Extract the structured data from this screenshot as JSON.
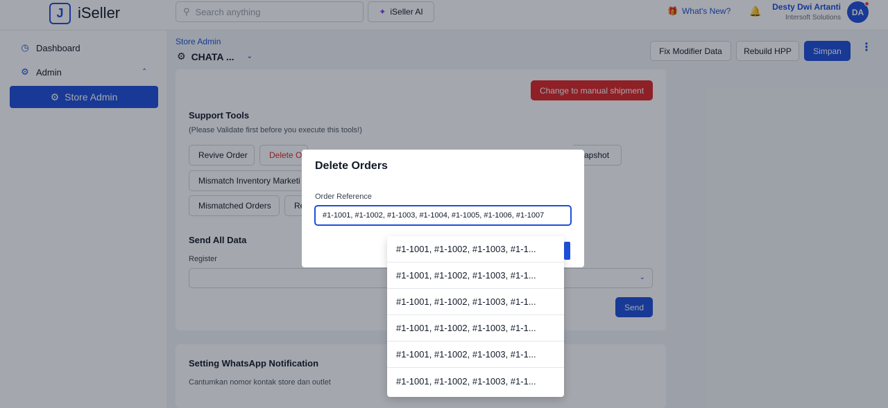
{
  "topbar": {
    "logo_text": "iSeller",
    "search_placeholder": "Search anything",
    "ai_label": "iSeller AI",
    "whats_new": "What's New?",
    "user_name": "Desty Dwi Artanti",
    "user_org": "Intersoft Solutions",
    "avatar_initials": "DA"
  },
  "sidebar": {
    "items": [
      {
        "label": "Dashboard",
        "icon": "dashboard-icon"
      },
      {
        "label": "Admin",
        "icon": "gear-icon"
      },
      {
        "label": "Store Admin",
        "icon": "gear-icon"
      }
    ]
  },
  "header": {
    "breadcrumb": "Store Admin",
    "title": "CHATA ...",
    "buttons": [
      "Fix Modifier Data",
      "Rebuild HPP",
      "Simpan"
    ]
  },
  "card": {
    "manual_shipment": "Change to manual shipment",
    "support_tools_title": "Support Tools",
    "support_tools_sub": "(Please Validate first before you execute this tools!)",
    "tool_buttons": [
      "Revive Order",
      "Delete O",
      "apshot",
      "Mismatch Inventory Marketi",
      "Mismatched Orders",
      "Re"
    ],
    "send_all_title": "Send All Data",
    "register_label": "Register",
    "send_label": "Send"
  },
  "card2": {
    "title": "Setting WhatsApp Notification",
    "subtitle": "Cantumkan nomor kontak store dan outlet"
  },
  "modal": {
    "title": "Delete Orders",
    "label": "Order Reference",
    "value": "#1-1001, #1-1002, #1-1003, #1-1004, #1-1005, #1-1006, #1-1007"
  },
  "dropdown": {
    "items": [
      "#1-1001, #1-1002, #1-1003, #1-1...",
      "#1-1001, #1-1002, #1-1003, #1-1...",
      "#1-1001, #1-1002, #1-1003, #1-1...",
      "#1-1001, #1-1002, #1-1003, #1-1...",
      "#1-1001, #1-1002, #1-1003, #1-1...",
      "#1-1001, #1-1002, #1-1003, #1-1..."
    ]
  },
  "colors": {
    "primary": "#1d4ed8",
    "danger": "#dc2626"
  }
}
